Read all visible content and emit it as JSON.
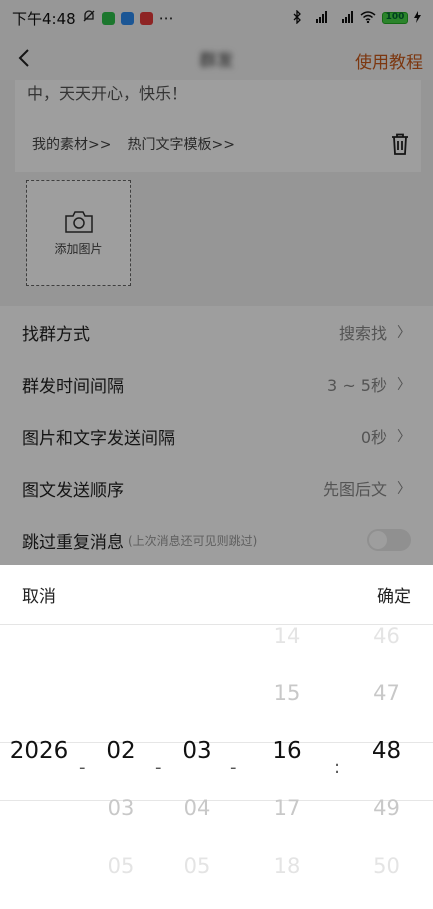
{
  "status_bar": {
    "time": "下午4:48",
    "extra": "⋯",
    "signal1": "HD",
    "signal2": "HD",
    "battery": "100"
  },
  "header": {
    "title": "群发",
    "tutorial": "使用教程"
  },
  "content": {
    "text_line": "中，天天开心，快乐！",
    "my_materials": "我的素材>>",
    "hot_templates": "热门文字模板>>",
    "add_image": "添加图片"
  },
  "settings": [
    {
      "label": "找群方式",
      "value": "搜索找"
    },
    {
      "label": "群发时间间隔",
      "value": "3 ~ 5秒"
    },
    {
      "label": "图片和文字发送间隔",
      "value": "0秒"
    },
    {
      "label": "图文发送顺序",
      "value": "先图后文"
    },
    {
      "label": "跳过重复消息",
      "hint": "(上次消息还可见则跳过)",
      "toggle": false
    }
  ],
  "picker": {
    "cancel": "取消",
    "confirm": "确定",
    "year": {
      "values": [
        "",
        "",
        "2026",
        "",
        ""
      ]
    },
    "month": {
      "values": [
        "",
        "",
        "02",
        "03",
        "05"
      ]
    },
    "day": {
      "values": [
        "",
        "",
        "03",
        "04",
        "05"
      ]
    },
    "hour": {
      "values": [
        "14",
        "15",
        "16",
        "17",
        "18"
      ]
    },
    "minute": {
      "values": [
        "46",
        "47",
        "48",
        "49",
        "50"
      ]
    },
    "sep_date": "-",
    "sep_time": ":"
  },
  "colors": {
    "accent": "#c85a1a",
    "overlay": "rgba(0,0,0,0.38)"
  }
}
